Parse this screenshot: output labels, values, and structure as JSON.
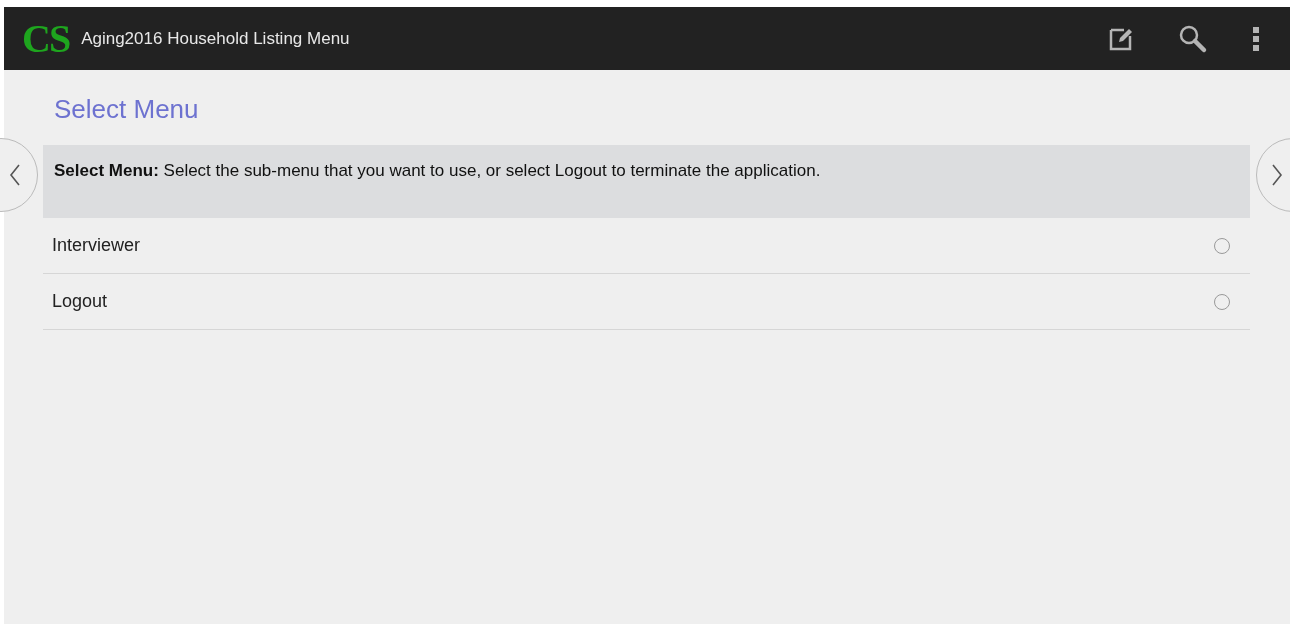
{
  "app_bar": {
    "logo": "CS",
    "title": "Aging2016 Household Listing Menu"
  },
  "page_title": "Select Menu",
  "prompt": "**Select Menu:** Select the sub-menu that you want to use, or select Logout to terminate the application.",
  "options": [
    {
      "label": "Interviewer",
      "selected": false
    },
    {
      "label": "Logout",
      "selected": false
    }
  ]
}
